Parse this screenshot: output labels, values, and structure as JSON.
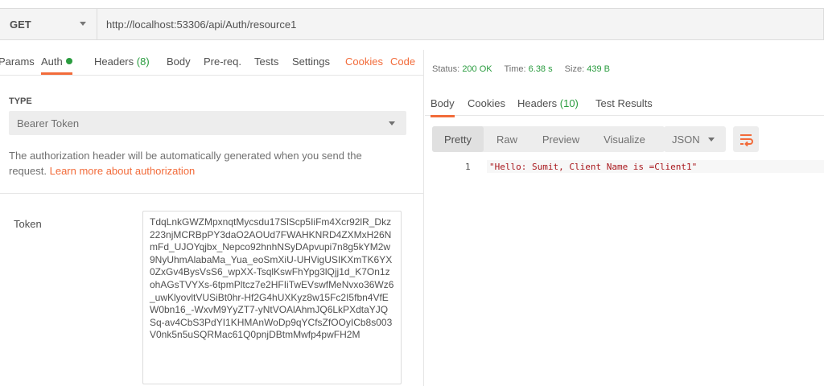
{
  "request": {
    "method": "GET",
    "url": "http://localhost:53306/api/Auth/resource1"
  },
  "request_tabs": {
    "params": "Params",
    "auth": "Auth",
    "headers": "Headers",
    "headers_count": "(8)",
    "body": "Body",
    "prereq": "Pre-req.",
    "tests": "Tests",
    "settings": "Settings",
    "cookies": "Cookies",
    "code": "Code"
  },
  "auth": {
    "type_label": "TYPE",
    "type_value": "Bearer Token",
    "description": "The authorization header will be automatically generated when you send the request.",
    "learn_more": "Learn more about authorization",
    "token_label": "Token",
    "token_value": "TdqLnkGWZMpxnqtMycsdu17SlScp5IiFm4Xcr92lR_Dkz223njMCRBpPY3daO2AOUd7FWAHKNRD4ZXMxH26NmFd_UJOYqjbx_Nepco92hnhNSyDApvupi7n8g5kYM2w9NyUhmAlabaMa_Yua_eoSmXiU-UHVigUSIKXmTK6YX0ZxGv4BysVsS6_wpXX-TsqlKswFhYpg3lQjj1d_K7On1zohAGsTVYXs-6tpmPltcz7e2HFIiTwEVswfMeNvxo36Wz6_uwKlyovltVUSiBt0hr-Hf2G4hUXKyz8w15Fc2I5fbn4VfEW0bn16_-WxvM9YyZT7-yNtVOAlAhmJQ6LkPXdtaYJQSq-av4CbS3PdYI1KHMAnWoDp9qYCfsZfOOyICb8s003V0nk5n5uSQRMac61Q0pnjDBtmMwfp4pwFH2M"
  },
  "response": {
    "status_label": "Status:",
    "status_value": "200 OK",
    "time_label": "Time:",
    "time_value": "6.38 s",
    "size_label": "Size:",
    "size_value": "439 B",
    "tabs": {
      "body": "Body",
      "cookies": "Cookies",
      "headers": "Headers",
      "headers_count": "(10)",
      "test_results": "Test Results"
    },
    "formats": {
      "pretty": "Pretty",
      "raw": "Raw",
      "preview": "Preview",
      "visualize": "Visualize",
      "language": "JSON"
    },
    "line_number": "1",
    "body_text": "\"Hello: Sumit, Client Name is =Client1\""
  },
  "colors": {
    "accent": "#f26b3a",
    "success": "#2a9c3f",
    "string": "#a8161b"
  },
  "icons": {
    "method_dropdown": "chevron-down-icon",
    "type_dropdown": "chevron-down-icon",
    "language_dropdown": "chevron-down-icon",
    "wrap": "wrap-lines-icon",
    "auth_status": "status-dot-icon"
  }
}
